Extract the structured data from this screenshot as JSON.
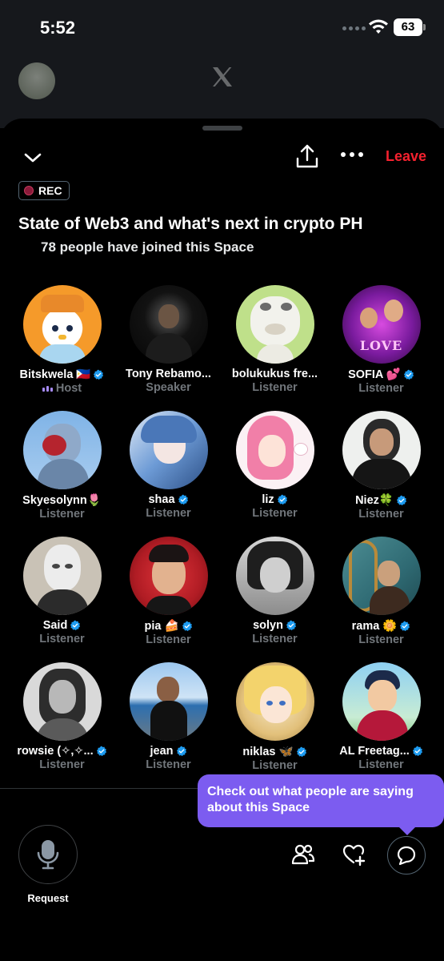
{
  "status_bar": {
    "time": "5:52",
    "battery": "63"
  },
  "space": {
    "rec_label": "REC",
    "leave_label": "Leave",
    "title": "State of Web3 and what's next in crypto PH",
    "joined_text": "78 people have joined this Space"
  },
  "participants": [
    {
      "name": "Bitskwela 🇵🇭",
      "role": "Host",
      "verified": true
    },
    {
      "name": "Tony Rebamo...",
      "role": "Speaker",
      "verified": false
    },
    {
      "name": "bolukukus fre...",
      "role": "Listener",
      "verified": false
    },
    {
      "name": "SOFIA 💕",
      "role": "Listener",
      "verified": true
    },
    {
      "name": "Skyesolynn🌷",
      "role": "Listener",
      "verified": false
    },
    {
      "name": "shaa",
      "role": "Listener",
      "verified": true
    },
    {
      "name": "liz",
      "role": "Listener",
      "verified": true
    },
    {
      "name": "Niez🍀",
      "role": "Listener",
      "verified": true
    },
    {
      "name": "Said",
      "role": "Listener",
      "verified": true
    },
    {
      "name": "pia 🍰",
      "role": "Listener",
      "verified": true
    },
    {
      "name": "solyn",
      "role": "Listener",
      "verified": true
    },
    {
      "name": "rama 🌼",
      "role": "Listener",
      "verified": true
    },
    {
      "name": "rowsie (✧,✧...",
      "role": "Listener",
      "verified": true
    },
    {
      "name": "jean",
      "role": "Listener",
      "verified": true
    },
    {
      "name": "niklas 🦋",
      "role": "Listener",
      "verified": true
    },
    {
      "name": "AL Freetag...",
      "role": "Listener",
      "verified": true
    }
  ],
  "bottom_bar": {
    "request_label": "Request",
    "tooltip": "Check out what people are saying about this Space"
  },
  "colors": {
    "accent": "#1d9bf0",
    "leave": "#f4212e",
    "tooltip": "#7c5cf0",
    "muted": "#71767b"
  },
  "icons": [
    "chevron-down-icon",
    "share-icon",
    "more-icon",
    "microphone-icon",
    "people-icon",
    "heart-plus-icon",
    "chat-icon",
    "verified-icon",
    "wifi-icon",
    "x-logo-icon"
  ]
}
